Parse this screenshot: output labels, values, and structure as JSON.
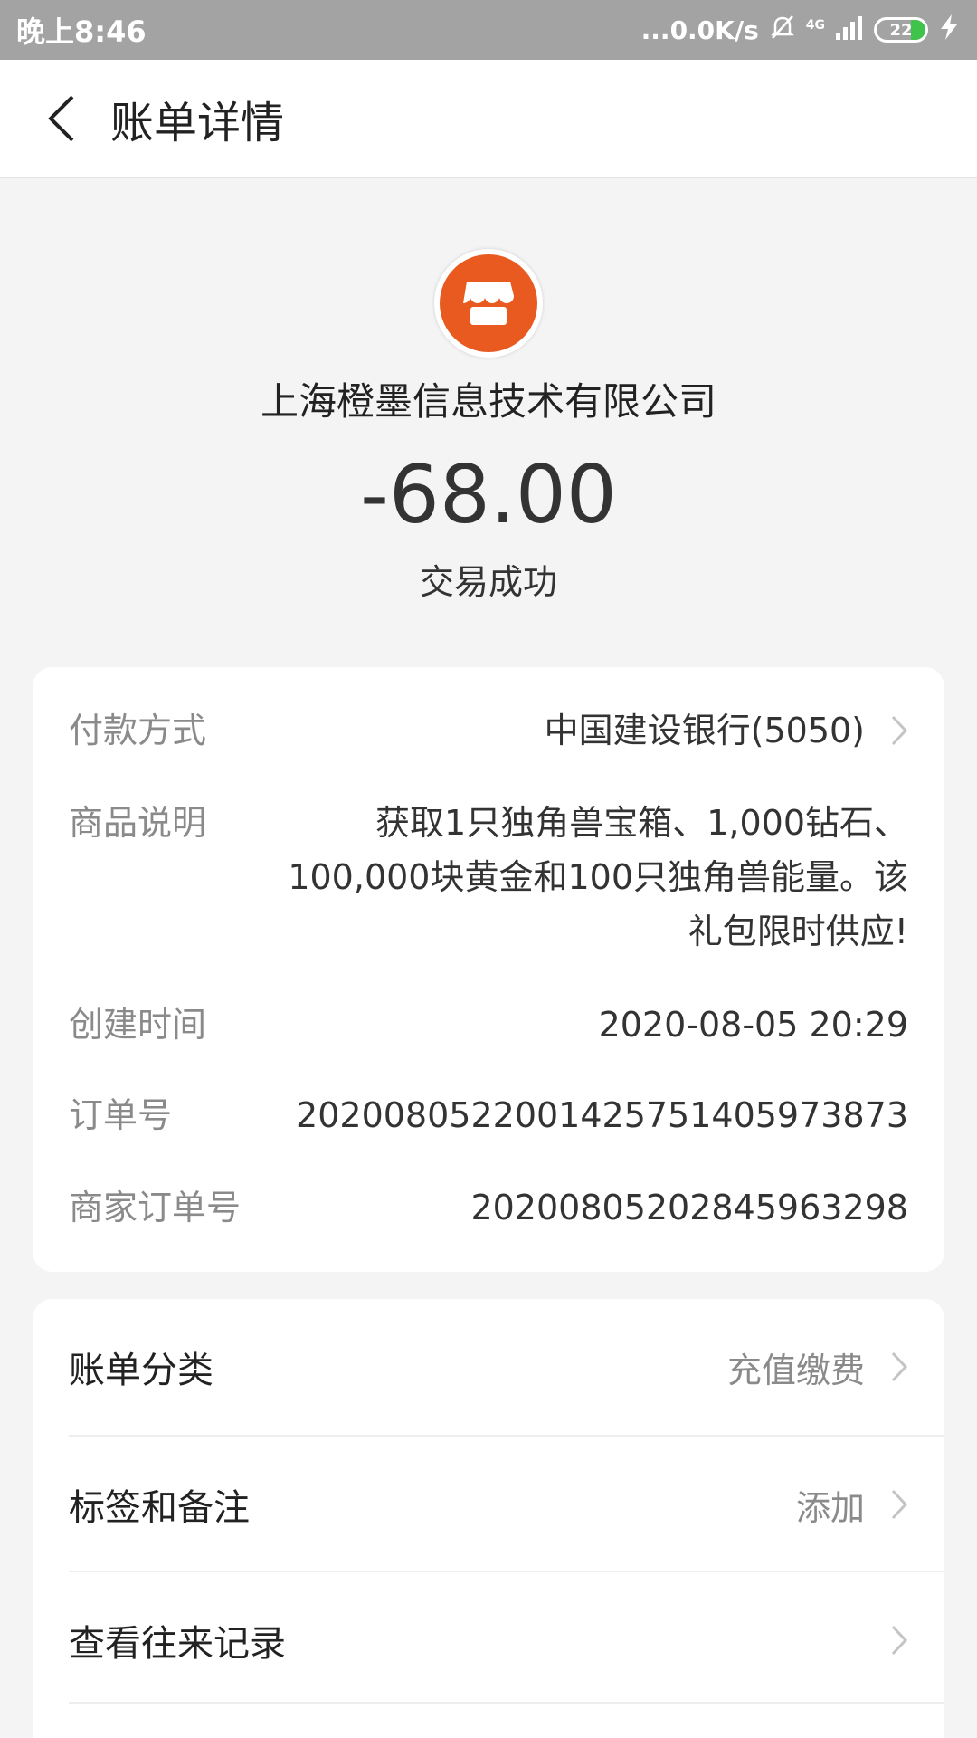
{
  "status_bar": {
    "time": "晚上8:46",
    "network_speed": "...0.0K/s",
    "network_type": "4G",
    "battery": "22"
  },
  "header": {
    "title": "账单详情"
  },
  "merchant": {
    "name": "上海橙墨信息技术有限公司",
    "amount": "-68.00",
    "status": "交易成功",
    "logo_color": "#e95a21"
  },
  "details": {
    "payment_method": {
      "label": "付款方式",
      "value": "中国建设银行(5050)"
    },
    "description": {
      "label": "商品说明",
      "value": "获取1只独角兽宝箱、1,000钻石、100,000块黄金和100只独角兽能量。该礼包限时供应!"
    },
    "created_time": {
      "label": "创建时间",
      "value": "2020-08-05 20:29"
    },
    "order_no": {
      "label": "订单号",
      "value": "2020080522001425751405973873"
    },
    "merchant_order_no": {
      "label": "商家订单号",
      "value": "2020080520284596329​8"
    }
  },
  "actions": {
    "category": {
      "label": "账单分类",
      "value": "充值缴费"
    },
    "tags": {
      "label": "标签和备注",
      "value": "添加"
    },
    "history": {
      "label": "查看往来记录"
    }
  }
}
